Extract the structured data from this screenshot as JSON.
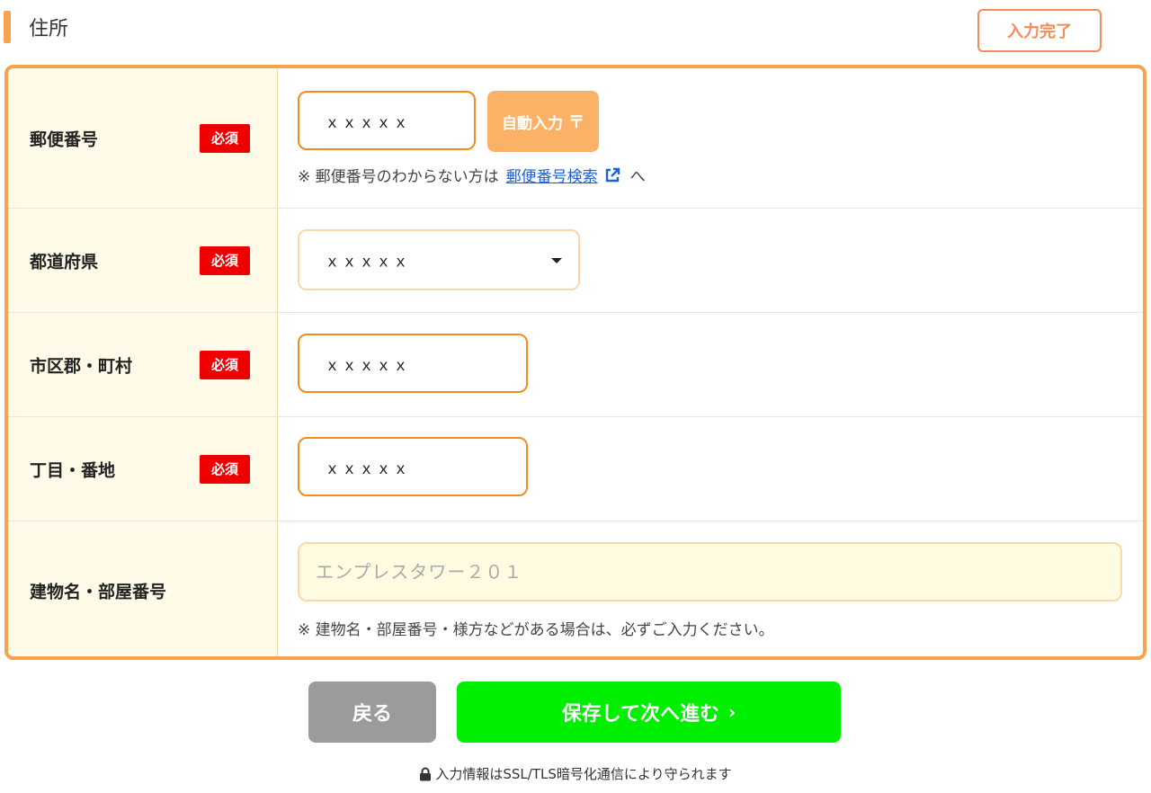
{
  "section": {
    "title": "住所",
    "complete_label": "入力完了"
  },
  "fields": {
    "postal_code": {
      "label": "郵便番号",
      "required_label": "必須",
      "value": "ｘｘｘｘｘ",
      "auto_button_label": "自動入力",
      "postal_mark": "〒",
      "hint_prefix": "※ 郵便番号のわからない方は",
      "hint_link": "郵便番号検索",
      "hint_suffix": "へ"
    },
    "prefecture": {
      "label": "都道府県",
      "required_label": "必須",
      "selected": "ｘｘｘｘｘ"
    },
    "city": {
      "label": "市区郡・町村",
      "required_label": "必須",
      "value": "ｘｘｘｘｘ"
    },
    "street": {
      "label": "丁目・番地",
      "required_label": "必須",
      "value": "ｘｘｘｘｘ"
    },
    "building": {
      "label": "建物名・部屋番号",
      "placeholder": "エンプレスタワー２０１",
      "hint": "※ 建物名・部屋番号・様方などがある場合は、必ずご入力ください。"
    }
  },
  "actions": {
    "back_label": "戻る",
    "next_label": "保存して次へ進む"
  },
  "footer": {
    "ssl_note": "入力情報はSSL/TLS暗号化通信により守られます"
  },
  "colors": {
    "accent_orange": "#f7a24f",
    "required_red": "#ee0000",
    "next_green": "#00ee00",
    "back_gray": "#9b9b9b",
    "link_blue": "#1a62d6"
  }
}
